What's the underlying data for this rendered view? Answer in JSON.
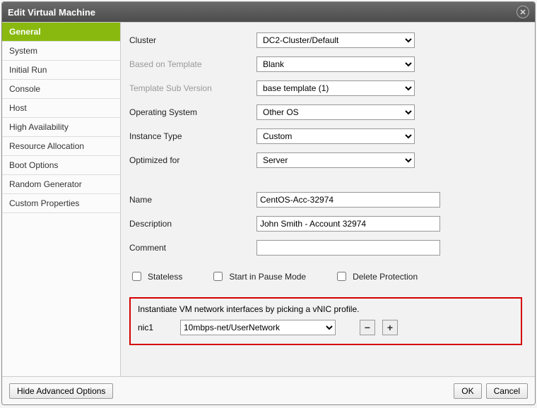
{
  "title": "Edit Virtual Machine",
  "sidebar": {
    "items": [
      {
        "label": "General"
      },
      {
        "label": "System"
      },
      {
        "label": "Initial Run"
      },
      {
        "label": "Console"
      },
      {
        "label": "Host"
      },
      {
        "label": "High Availability"
      },
      {
        "label": "Resource Allocation"
      },
      {
        "label": "Boot Options"
      },
      {
        "label": "Random Generator"
      },
      {
        "label": "Custom Properties"
      }
    ],
    "active_index": 0
  },
  "form": {
    "cluster": {
      "label": "Cluster",
      "value": "DC2-Cluster/Default"
    },
    "template": {
      "label": "Based on Template",
      "value": "Blank"
    },
    "templateSub": {
      "label": "Template Sub Version",
      "value": "base template (1)"
    },
    "os": {
      "label": "Operating System",
      "value": "Other OS"
    },
    "instanceType": {
      "label": "Instance Type",
      "value": "Custom"
    },
    "optimizedFor": {
      "label": "Optimized for",
      "value": "Server"
    },
    "name": {
      "label": "Name",
      "value": "CentOS-Acc-32974"
    },
    "description": {
      "label": "Description",
      "value": "John Smith - Account 32974"
    },
    "comment": {
      "label": "Comment",
      "value": ""
    }
  },
  "checks": {
    "stateless": {
      "label": "Stateless",
      "checked": false
    },
    "pause": {
      "label": "Start in Pause Mode",
      "checked": false
    },
    "deleteProt": {
      "label": "Delete Protection",
      "checked": false
    }
  },
  "nic": {
    "hint": "Instantiate VM network interfaces by picking a vNIC profile.",
    "label": "nic1",
    "value": "10mbps-net/UserNetwork"
  },
  "footer": {
    "advanced": "Hide Advanced Options",
    "ok": "OK",
    "cancel": "Cancel"
  }
}
